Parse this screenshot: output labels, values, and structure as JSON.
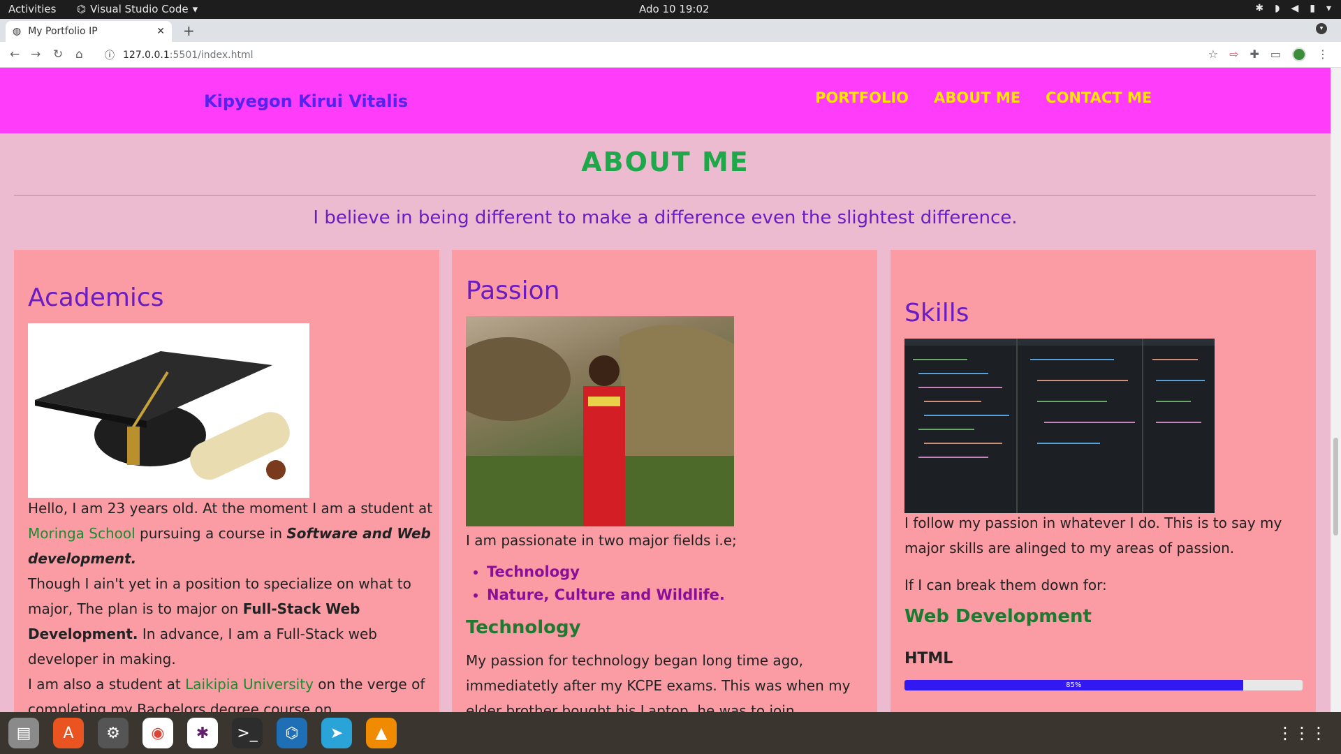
{
  "system": {
    "activities": "Activities",
    "app_name": "Visual Studio Code",
    "clock": "Ado 10  19:02"
  },
  "browser": {
    "tab_title": "My Portfolio IP",
    "url_host": "127.0.0.1",
    "url_rest": ":5501/index.html"
  },
  "site": {
    "brand": "Kipyegon Kirui Vitalis",
    "nav": [
      "PORTFOLIO",
      "ABOUT ME",
      "CONTACT ME"
    ],
    "section_title": "ABOUT ME",
    "motto": "I believe in being different to make a difference even the slightest difference."
  },
  "academics": {
    "title": "Academics",
    "p1_a": "Hello, I am 23 years old. At the moment I am a student at ",
    "p1_school": "Moringa School",
    "p1_b": " pursuing a course in ",
    "p1_course": "Software and Web development.",
    "p2_a": "Though I ain't yet in a position to specialize on what to major, The plan is to major on ",
    "p2_major": "Full-Stack Web Development.",
    "p2_b": " In advance, I am a Full-Stack web developer in making.",
    "p3_a": "I am also a student at ",
    "p3_uni": "Laikipia University",
    "p3_b": " on the verge of completing my Bachelors degree course on"
  },
  "passion": {
    "title": "Passion",
    "intro": "I am passionate in two major fields i.e;",
    "fields": [
      "Technology",
      "Nature, Culture and Wildlife."
    ],
    "subtitle": "Technology",
    "body": "My passion for technology began long time ago, immediatetly after my KCPE exams. This was when my elder brother bought his Laptop, he was to join"
  },
  "skills": {
    "title": "Skills",
    "p1": "I follow my passion in whatever I do. This is to say my major skills are alinged to my areas of passion.",
    "p2": "If I can break them down for:",
    "subtitle": "Web Development",
    "items": [
      {
        "name": "HTML",
        "percent": 85,
        "label": "85%"
      }
    ]
  }
}
